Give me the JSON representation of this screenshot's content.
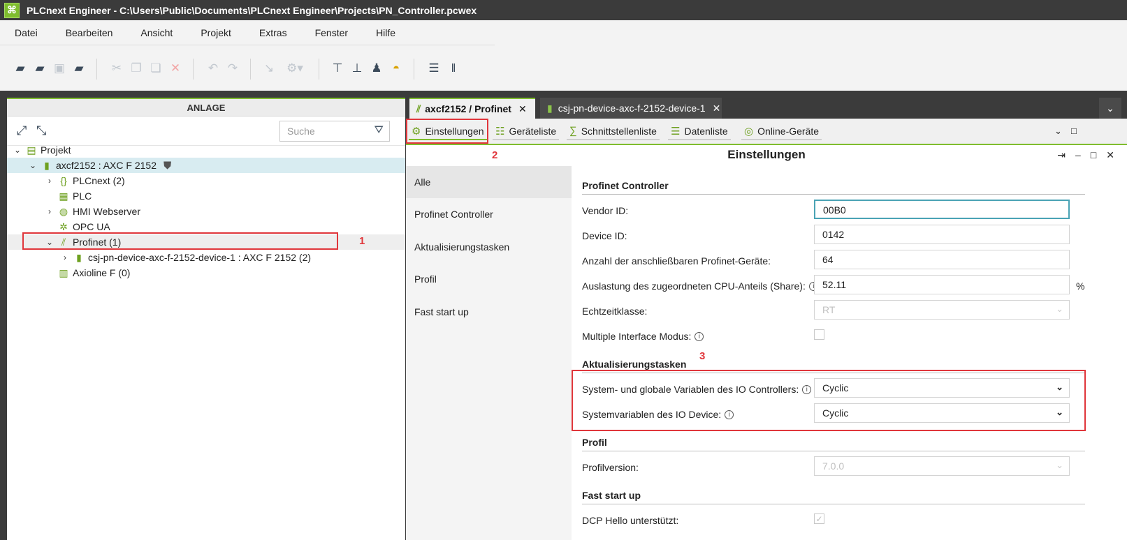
{
  "window": {
    "title": "PLCnext Engineer - C:\\Users\\Public\\Documents\\PLCnext Engineer\\Projects\\PN_Controller.pcwex"
  },
  "menu": [
    "Datei",
    "Bearbeiten",
    "Ansicht",
    "Projekt",
    "Extras",
    "Fenster",
    "Hilfe"
  ],
  "icons": [
    "new-project-icon",
    "open-project-icon",
    "save-icon",
    "save-as-icon",
    "cut-icon",
    "copy-icon",
    "paste-icon",
    "delete-icon",
    "undo-icon",
    "redo-icon",
    "connect-icon",
    "settings-dropdown-icon",
    "build-icon",
    "network-icon",
    "monitor-icon",
    "debug-icon",
    "layout-list-icon",
    "layout-columns-icon"
  ],
  "left_panel": {
    "title": "ANLAGE",
    "search_placeholder": "Suche",
    "tree": [
      {
        "label": "Projekt"
      },
      {
        "label": "axcf2152 : AXC F 2152"
      },
      {
        "label": "PLCnext (2)"
      },
      {
        "label": "PLC"
      },
      {
        "label": "HMI Webserver"
      },
      {
        "label": "OPC UA"
      },
      {
        "label": "Profinet (1)"
      },
      {
        "label": "csj-pn-device-axc-f-2152-device-1 : AXC F 2152 (2)"
      },
      {
        "label": "Axioline F (0)"
      }
    ]
  },
  "annotations": {
    "n1": "1",
    "n2": "2",
    "n3": "3"
  },
  "editor": {
    "tabs": [
      {
        "label": "axcf2152 / Profinet",
        "close": "✕"
      },
      {
        "label": "csj-pn-device-axc-f-2152-device-1",
        "close": "✕"
      }
    ],
    "tab_more": "⌄",
    "toolbar": [
      "Einstellungen",
      "Geräteliste",
      "Schnittstellenliste",
      "Datenliste",
      "Online-Geräte"
    ],
    "view_title": "Einstellungen",
    "nav": [
      "Alle",
      "Profinet Controller",
      "Aktualisierungstasken",
      "Profil",
      "Fast start up"
    ],
    "sections": {
      "controller": "Profinet Controller",
      "tasks": "Aktualisierungstasken",
      "profil": "Profil",
      "fast": "Fast start up"
    },
    "fields": {
      "vendor_id": {
        "label": "Vendor ID:",
        "value": "00B0"
      },
      "device_id": {
        "label": "Device ID:",
        "value": "0142"
      },
      "anzahl": {
        "label": "Anzahl der anschließbaren Profinet-Geräte:",
        "value": "64"
      },
      "auslastung": {
        "label": "Auslastung des zugeordneten CPU-Anteils (Share):",
        "value": "52.11",
        "unit": "%"
      },
      "echtzeit": {
        "label": "Echtzeitklasse:",
        "value": "RT"
      },
      "multiple": {
        "label": "Multiple Interface Modus:"
      },
      "sys_global": {
        "label": "System- und globale Variablen des IO Controllers:",
        "value": "Cyclic"
      },
      "sys_device": {
        "label": "Systemvariablen des IO Device:",
        "value": "Cyclic"
      },
      "profilversion": {
        "label": "Profilversion:",
        "value": "7.0.0"
      },
      "dcp": {
        "label": "DCP Hello unterstützt:"
      }
    },
    "info_glyph": "i"
  }
}
